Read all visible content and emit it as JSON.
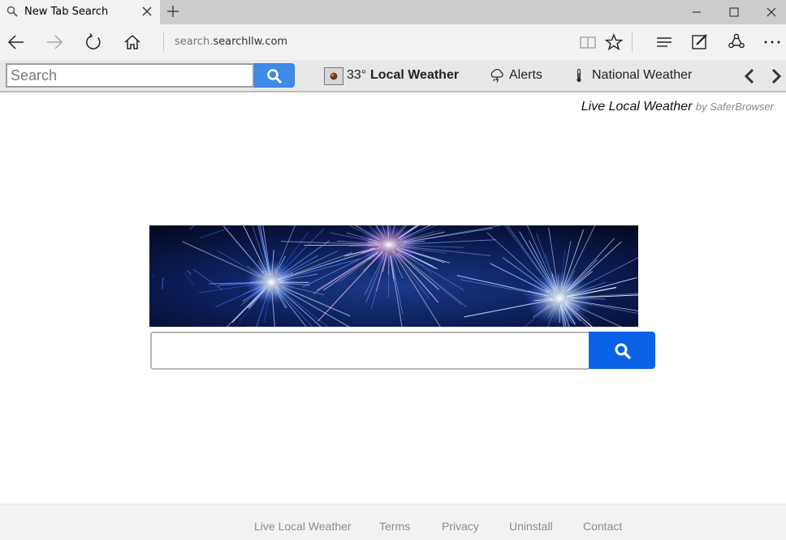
{
  "browser": {
    "tab_title": "New Tab Search",
    "address_prefix": "search.",
    "address_host": "searchllw.com"
  },
  "toolbar": {
    "search_placeholder": "Search",
    "temperature": "33°",
    "local_weather_label": "Local Weather",
    "alerts_label": "Alerts",
    "national_weather_label": "National Weather"
  },
  "brand": {
    "name": "Live Local Weather",
    "by": "by SaferBrowser"
  },
  "footer": {
    "links": [
      "Live Local Weather",
      "Terms",
      "Privacy",
      "Uninstall",
      "Contact"
    ]
  },
  "colors": {
    "accent_blue": "#0a62e6",
    "toolbar_blue": "#3f8be8"
  },
  "icons": [
    "search-icon",
    "close-icon",
    "plus-icon",
    "minimize-icon",
    "maximize-icon",
    "window-close-icon",
    "back-arrow-icon",
    "forward-arrow-icon",
    "refresh-icon",
    "home-icon",
    "reading-view-icon",
    "favorite-star-icon",
    "hub-icon",
    "web-note-icon",
    "share-icon",
    "more-icon",
    "weather-icon",
    "alerts-icon",
    "thermometer-icon",
    "chevron-left-icon",
    "chevron-right-icon"
  ]
}
